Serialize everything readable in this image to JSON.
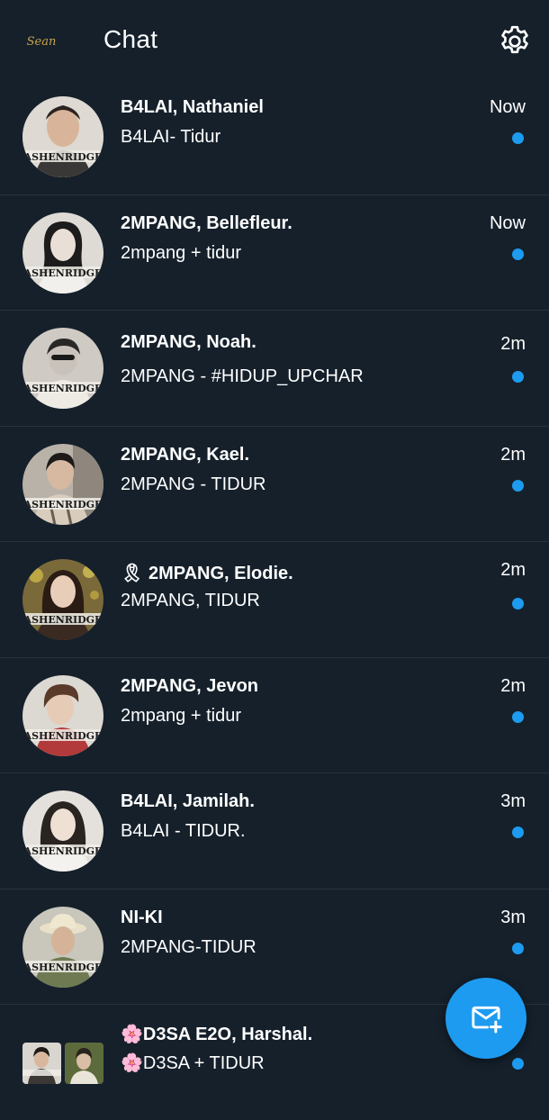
{
  "header": {
    "logo_text": "Sean",
    "title": "Chat",
    "settings_icon": "gear-icon"
  },
  "chats": [
    {
      "name": "B4LAI, Nathaniel",
      "preview": "B4LAI- Tidur",
      "time": "Now",
      "unread": true
    },
    {
      "name": "2MPANG, Bellefleur.",
      "preview": "2mpang + tidur",
      "time": "Now",
      "unread": true
    },
    {
      "name": "2MPANG, Noah.",
      "preview": "2MPANG - #HIDUP_UPCHAR",
      "time": "2m",
      "unread": true
    },
    {
      "name": "2MPANG, Kael.",
      "preview": "2MPANG - TIDUR",
      "time": "2m",
      "unread": true
    },
    {
      "name": "🎗 2MPANG, Elodie.",
      "preview": "2MPANG, TIDUR",
      "time": "2m",
      "unread": true
    },
    {
      "name": "2MPANG, Jevon",
      "preview": "2mpang + tidur",
      "time": "2m",
      "unread": true
    },
    {
      "name": "B4LAI, Jamilah.",
      "preview": "B4LAI - TIDUR.",
      "time": "3m",
      "unread": true
    },
    {
      "name": "NI-KI",
      "preview": "2MPANG-TIDUR",
      "time": "3m",
      "unread": true
    },
    {
      "name": "🌸D3SA E2O, Harshal.",
      "preview": "🌸D3SA + TIDUR",
      "time": "",
      "unread": true
    }
  ],
  "fab": {
    "icon": "new-message-icon"
  },
  "colors": {
    "background": "#15202b",
    "accent": "#1d9bf0",
    "divider": "#26333f"
  }
}
